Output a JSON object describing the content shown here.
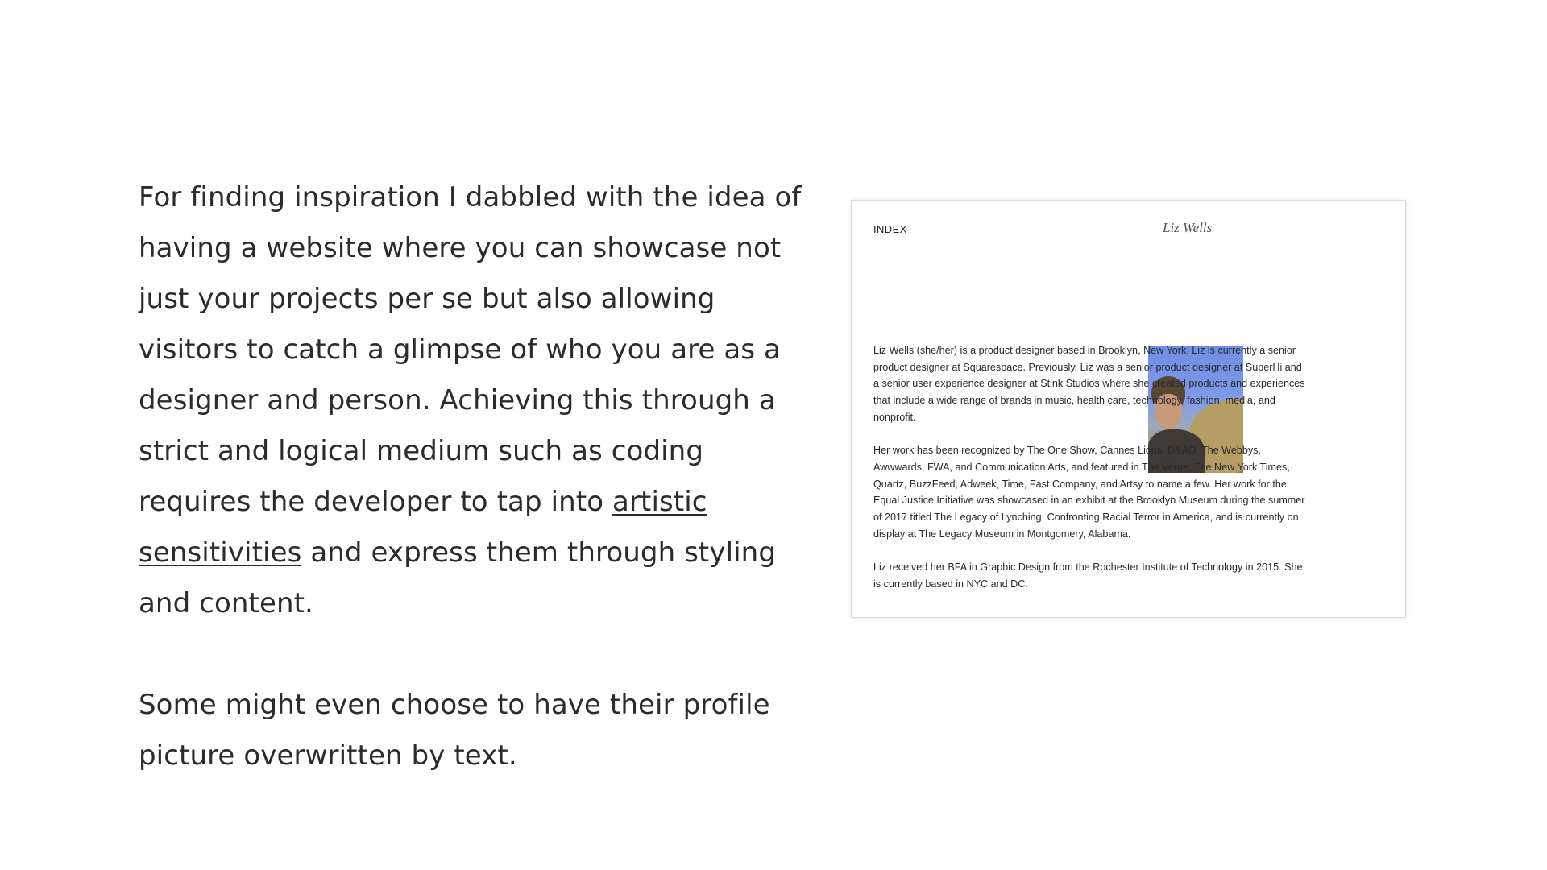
{
  "article": {
    "paragraph1": {
      "before_link": "For finding inspiration I dabbled with the idea of having a website where you can showcase not just your projects per se but also allowing visitors to catch a glimpse of who you are as a designer and person. Achieving this through a strict and logical medium such as coding requires the developer to tap into ",
      "link_text": "artistic sensitivities",
      "after_link": " and express them through styling and content."
    },
    "paragraph2": "Some might even choose to have their profile picture overwritten by text."
  },
  "screenshot": {
    "nav_label": "INDEX",
    "site_title": "Liz Wells",
    "bio_paragraphs": [
      "Liz Wells (she/her) is a product designer based in Brooklyn, New York. Liz is currently a senior product designer at Squarespace. Previously, Liz was a senior product designer at SuperHi and a senior user experience designer at Stink Studios where she created products and experiences that include a wide range of brands in music, health care, technology, fashion, media, and nonprofit.",
      "Her work has been recognized by The One Show, Cannes Lions, D&AD, The Webbys, Awwwards, FWA, and Communication Arts, and featured in The Verge, The New York Times, Quartz, BuzzFeed, Adweek, Time, Fast Company, and Artsy to name a few. Her work for the Equal Justice Initiative was showcased in an exhibit at the Brooklyn Museum during the summer of 2017 titled The Legacy of Lynching: Confronting Racial Terror in America, and is currently on display at The Legacy Museum in Montgomery, Alabama.",
      "Liz received her BFA in Graphic Design from the Rochester Institute of Technology in 2015. She is currently based in NYC and DC."
    ]
  }
}
